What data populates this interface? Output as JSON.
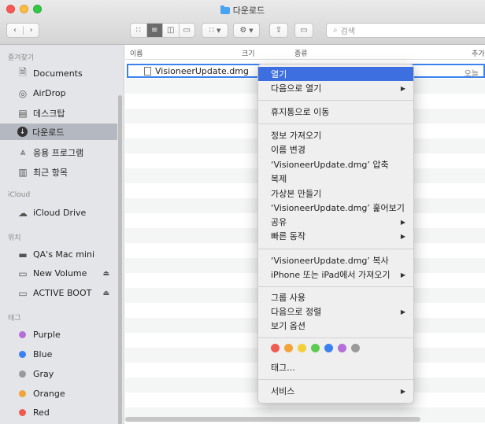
{
  "window": {
    "title": "다운로드"
  },
  "toolbar": {
    "back_icon": "chevron-left",
    "forward_icon": "chevron-right",
    "search_placeholder": "검색"
  },
  "sidebar": {
    "favorites_header": "즐겨찾기",
    "favorites": [
      {
        "label": "Documents",
        "icon": "document-icon"
      },
      {
        "label": "AirDrop",
        "icon": "airdrop-icon"
      },
      {
        "label": "데스크탑",
        "icon": "desktop-icon"
      },
      {
        "label": "다운로드",
        "icon": "download-icon",
        "selected": true
      },
      {
        "label": "응용 프로그램",
        "icon": "applications-icon"
      },
      {
        "label": "최근 항목",
        "icon": "recents-icon"
      }
    ],
    "icloud_header": "iCloud",
    "icloud": [
      {
        "label": "iCloud Drive",
        "icon": "cloud-icon"
      }
    ],
    "locations_header": "위치",
    "locations": [
      {
        "label": "QA's Mac mini",
        "icon": "computer-icon"
      },
      {
        "label": "New Volume",
        "icon": "disk-icon",
        "eject": true
      },
      {
        "label": "ACTIVE BOOT",
        "icon": "disk-icon",
        "eject": true
      }
    ],
    "tags_header": "태그",
    "tags": [
      {
        "label": "Purple",
        "color": "#b46fd8"
      },
      {
        "label": "Blue",
        "color": "#3b82f0"
      },
      {
        "label": "Gray",
        "color": "#9a9a9a"
      },
      {
        "label": "Orange",
        "color": "#f2a33a"
      },
      {
        "label": "Red",
        "color": "#ef5b4f"
      }
    ]
  },
  "columns": {
    "name": "이름",
    "size": "크기",
    "kind": "종류",
    "added": "추가"
  },
  "file": {
    "name": "VisioneerUpdate.dmg",
    "kind": "오늘"
  },
  "context_menu": {
    "open": "열기",
    "open_with": "다음으로 열기",
    "move_to_trash": "휴지통으로 이동",
    "get_info": "정보 가져오기",
    "rename": "이름 변경",
    "compress": "‘VisioneerUpdate.dmg’ 압축",
    "duplicate": "복제",
    "make_alias": "가상본 만들기",
    "quick_look": "‘VisioneerUpdate.dmg’ 훑어보기",
    "share": "공유",
    "quick_actions": "빠른 동작",
    "copy": "‘VisioneerUpdate.dmg’ 복사",
    "import_from_iphone": "iPhone 또는 iPad에서 가져오기",
    "use_groups": "그룹 사용",
    "sort_by": "다음으로 정렬",
    "view_options": "보기 옵션",
    "tag_colors": [
      "#ef5b4f",
      "#f2a33a",
      "#f5cf3a",
      "#5ccb4f",
      "#3b82f0",
      "#b46fd8",
      "#9a9a9a"
    ],
    "tags": "태그...",
    "services": "서비스"
  }
}
